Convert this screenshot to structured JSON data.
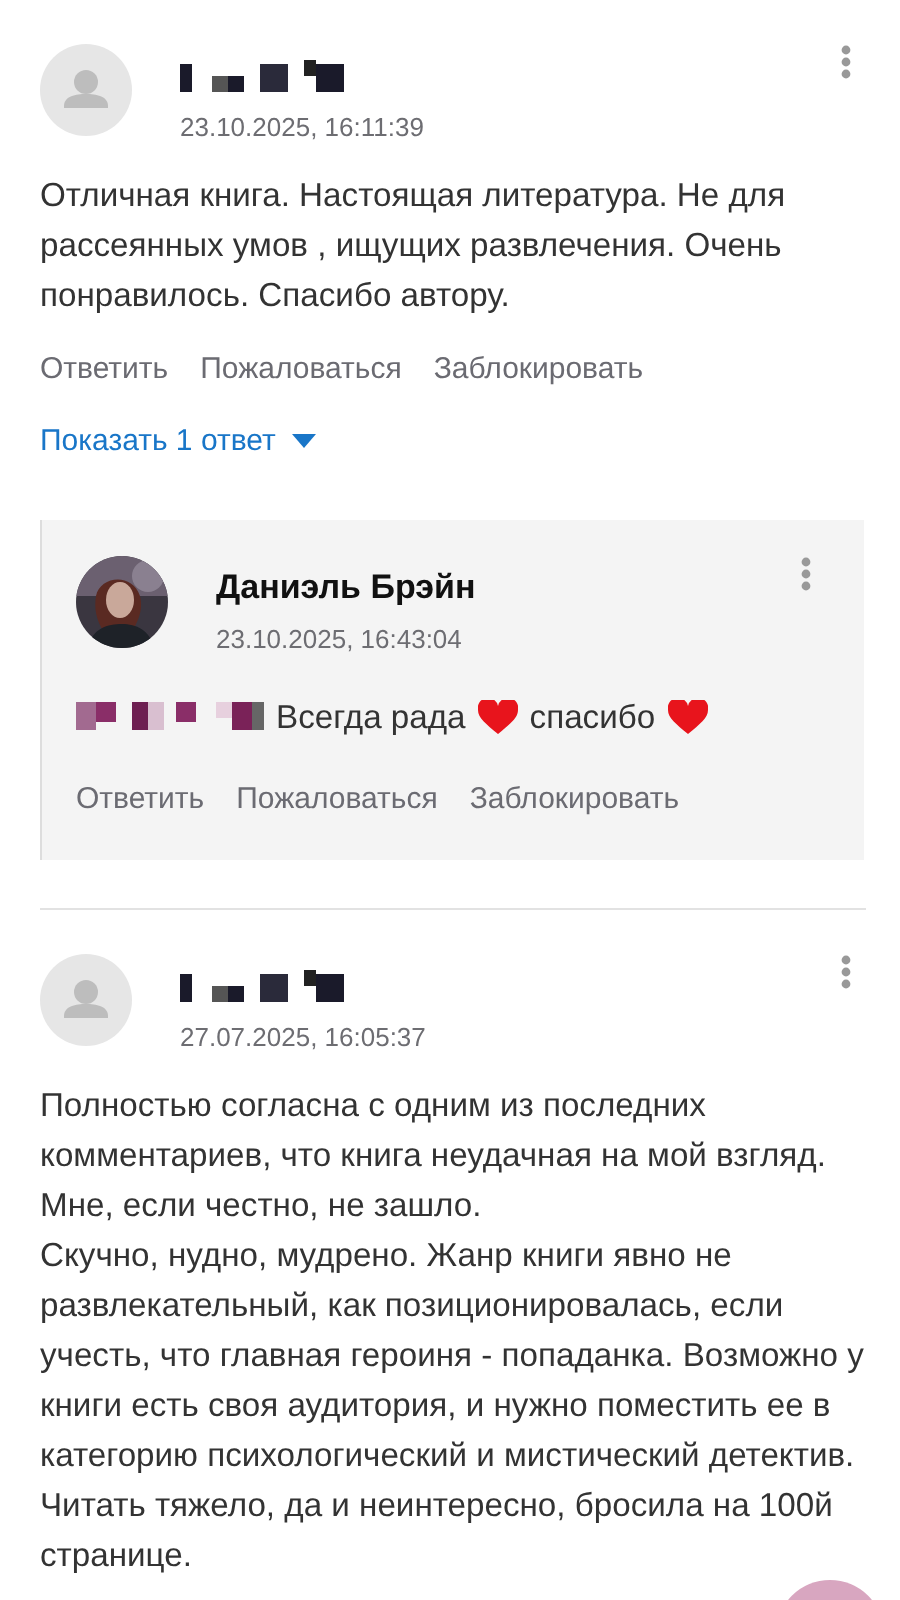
{
  "comments": [
    {
      "kind": "comment",
      "avatar": {
        "kind": "placeholder"
      },
      "name_hidden": true,
      "date": "23.10.2025, 16:11:39",
      "text": "Отличная книга. Настоящая литература. Не для рассеянных умов , ищущих развлечения. Очень понравилось. Спасибо автору.",
      "actions": [
        "Ответить",
        "Пожаловаться",
        "Заблокировать"
      ],
      "toggle": "Показать 1 ответ",
      "replies": [
        {
          "kind": "reply",
          "avatar": {
            "kind": "picture"
          },
          "name": "Даниэль Брэйн",
          "date": "23.10.2025, 16:43:04",
          "mention_hidden": true,
          "parts": [
            {
              "kind": "text",
              "text": "Всегда рада"
            },
            {
              "kind": "heart"
            },
            {
              "kind": "text",
              "text": "спасибо"
            },
            {
              "kind": "heart"
            }
          ],
          "actions": [
            "Ответить",
            "Пожаловаться",
            "Заблокировать"
          ]
        }
      ]
    },
    {
      "kind": "comment",
      "avatar": {
        "kind": "placeholder"
      },
      "name_hidden": true,
      "date": "27.07.2025, 16:05:37",
      "text": "Полностью согласна с одним из последних комментариев, что книга неудачная на мой взгляд.\nМне, если честно, не зашло.\nСкучно, нудно, мудрено. Жанр книги явно не развлекательный, как позиционировалась, если учесть, что главная героиня - попаданка. Возможно у книги есть своя аудитория, и нужно поместить ее в категорию психологический и мистический детектив. Читать тяжело, да и неинтересно, бросила на 100й странице."
    }
  ]
}
